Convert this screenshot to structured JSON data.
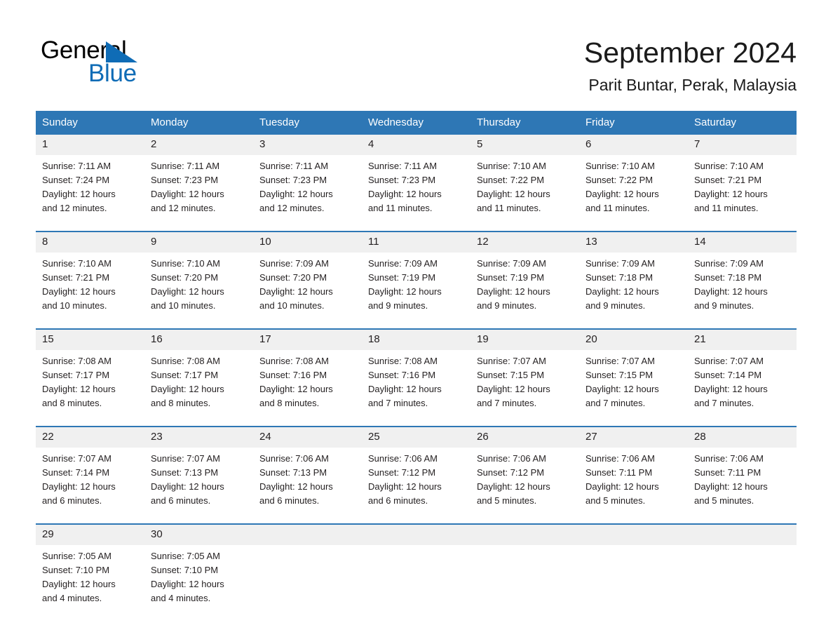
{
  "brand": {
    "name_part1": "General",
    "name_part2": "Blue",
    "triangle_color": "#0f6cb6"
  },
  "header": {
    "month_title": "September 2024",
    "location": "Parit Buntar, Perak, Malaysia"
  },
  "theme": {
    "header_blue": "#2e77b5",
    "daynum_background": "#f0f0f0",
    "text_color": "#231f20"
  },
  "calendar": {
    "weekday_headers": [
      "Sunday",
      "Monday",
      "Tuesday",
      "Wednesday",
      "Thursday",
      "Friday",
      "Saturday"
    ],
    "weeks": [
      [
        {
          "day": "1",
          "sunrise": "Sunrise: 7:11 AM",
          "sunset": "Sunset: 7:24 PM",
          "daylight_line1": "Daylight: 12 hours",
          "daylight_line2": "and 12 minutes."
        },
        {
          "day": "2",
          "sunrise": "Sunrise: 7:11 AM",
          "sunset": "Sunset: 7:23 PM",
          "daylight_line1": "Daylight: 12 hours",
          "daylight_line2": "and 12 minutes."
        },
        {
          "day": "3",
          "sunrise": "Sunrise: 7:11 AM",
          "sunset": "Sunset: 7:23 PM",
          "daylight_line1": "Daylight: 12 hours",
          "daylight_line2": "and 12 minutes."
        },
        {
          "day": "4",
          "sunrise": "Sunrise: 7:11 AM",
          "sunset": "Sunset: 7:23 PM",
          "daylight_line1": "Daylight: 12 hours",
          "daylight_line2": "and 11 minutes."
        },
        {
          "day": "5",
          "sunrise": "Sunrise: 7:10 AM",
          "sunset": "Sunset: 7:22 PM",
          "daylight_line1": "Daylight: 12 hours",
          "daylight_line2": "and 11 minutes."
        },
        {
          "day": "6",
          "sunrise": "Sunrise: 7:10 AM",
          "sunset": "Sunset: 7:22 PM",
          "daylight_line1": "Daylight: 12 hours",
          "daylight_line2": "and 11 minutes."
        },
        {
          "day": "7",
          "sunrise": "Sunrise: 7:10 AM",
          "sunset": "Sunset: 7:21 PM",
          "daylight_line1": "Daylight: 12 hours",
          "daylight_line2": "and 11 minutes."
        }
      ],
      [
        {
          "day": "8",
          "sunrise": "Sunrise: 7:10 AM",
          "sunset": "Sunset: 7:21 PM",
          "daylight_line1": "Daylight: 12 hours",
          "daylight_line2": "and 10 minutes."
        },
        {
          "day": "9",
          "sunrise": "Sunrise: 7:10 AM",
          "sunset": "Sunset: 7:20 PM",
          "daylight_line1": "Daylight: 12 hours",
          "daylight_line2": "and 10 minutes."
        },
        {
          "day": "10",
          "sunrise": "Sunrise: 7:09 AM",
          "sunset": "Sunset: 7:20 PM",
          "daylight_line1": "Daylight: 12 hours",
          "daylight_line2": "and 10 minutes."
        },
        {
          "day": "11",
          "sunrise": "Sunrise: 7:09 AM",
          "sunset": "Sunset: 7:19 PM",
          "daylight_line1": "Daylight: 12 hours",
          "daylight_line2": "and 9 minutes."
        },
        {
          "day": "12",
          "sunrise": "Sunrise: 7:09 AM",
          "sunset": "Sunset: 7:19 PM",
          "daylight_line1": "Daylight: 12 hours",
          "daylight_line2": "and 9 minutes."
        },
        {
          "day": "13",
          "sunrise": "Sunrise: 7:09 AM",
          "sunset": "Sunset: 7:18 PM",
          "daylight_line1": "Daylight: 12 hours",
          "daylight_line2": "and 9 minutes."
        },
        {
          "day": "14",
          "sunrise": "Sunrise: 7:09 AM",
          "sunset": "Sunset: 7:18 PM",
          "daylight_line1": "Daylight: 12 hours",
          "daylight_line2": "and 9 minutes."
        }
      ],
      [
        {
          "day": "15",
          "sunrise": "Sunrise: 7:08 AM",
          "sunset": "Sunset: 7:17 PM",
          "daylight_line1": "Daylight: 12 hours",
          "daylight_line2": "and 8 minutes."
        },
        {
          "day": "16",
          "sunrise": "Sunrise: 7:08 AM",
          "sunset": "Sunset: 7:17 PM",
          "daylight_line1": "Daylight: 12 hours",
          "daylight_line2": "and 8 minutes."
        },
        {
          "day": "17",
          "sunrise": "Sunrise: 7:08 AM",
          "sunset": "Sunset: 7:16 PM",
          "daylight_line1": "Daylight: 12 hours",
          "daylight_line2": "and 8 minutes."
        },
        {
          "day": "18",
          "sunrise": "Sunrise: 7:08 AM",
          "sunset": "Sunset: 7:16 PM",
          "daylight_line1": "Daylight: 12 hours",
          "daylight_line2": "and 7 minutes."
        },
        {
          "day": "19",
          "sunrise": "Sunrise: 7:07 AM",
          "sunset": "Sunset: 7:15 PM",
          "daylight_line1": "Daylight: 12 hours",
          "daylight_line2": "and 7 minutes."
        },
        {
          "day": "20",
          "sunrise": "Sunrise: 7:07 AM",
          "sunset": "Sunset: 7:15 PM",
          "daylight_line1": "Daylight: 12 hours",
          "daylight_line2": "and 7 minutes."
        },
        {
          "day": "21",
          "sunrise": "Sunrise: 7:07 AM",
          "sunset": "Sunset: 7:14 PM",
          "daylight_line1": "Daylight: 12 hours",
          "daylight_line2": "and 7 minutes."
        }
      ],
      [
        {
          "day": "22",
          "sunrise": "Sunrise: 7:07 AM",
          "sunset": "Sunset: 7:14 PM",
          "daylight_line1": "Daylight: 12 hours",
          "daylight_line2": "and 6 minutes."
        },
        {
          "day": "23",
          "sunrise": "Sunrise: 7:07 AM",
          "sunset": "Sunset: 7:13 PM",
          "daylight_line1": "Daylight: 12 hours",
          "daylight_line2": "and 6 minutes."
        },
        {
          "day": "24",
          "sunrise": "Sunrise: 7:06 AM",
          "sunset": "Sunset: 7:13 PM",
          "daylight_line1": "Daylight: 12 hours",
          "daylight_line2": "and 6 minutes."
        },
        {
          "day": "25",
          "sunrise": "Sunrise: 7:06 AM",
          "sunset": "Sunset: 7:12 PM",
          "daylight_line1": "Daylight: 12 hours",
          "daylight_line2": "and 6 minutes."
        },
        {
          "day": "26",
          "sunrise": "Sunrise: 7:06 AM",
          "sunset": "Sunset: 7:12 PM",
          "daylight_line1": "Daylight: 12 hours",
          "daylight_line2": "and 5 minutes."
        },
        {
          "day": "27",
          "sunrise": "Sunrise: 7:06 AM",
          "sunset": "Sunset: 7:11 PM",
          "daylight_line1": "Daylight: 12 hours",
          "daylight_line2": "and 5 minutes."
        },
        {
          "day": "28",
          "sunrise": "Sunrise: 7:06 AM",
          "sunset": "Sunset: 7:11 PM",
          "daylight_line1": "Daylight: 12 hours",
          "daylight_line2": "and 5 minutes."
        }
      ],
      [
        {
          "day": "29",
          "sunrise": "Sunrise: 7:05 AM",
          "sunset": "Sunset: 7:10 PM",
          "daylight_line1": "Daylight: 12 hours",
          "daylight_line2": "and 4 minutes."
        },
        {
          "day": "30",
          "sunrise": "Sunrise: 7:05 AM",
          "sunset": "Sunset: 7:10 PM",
          "daylight_line1": "Daylight: 12 hours",
          "daylight_line2": "and 4 minutes."
        },
        {
          "day": "",
          "sunrise": "",
          "sunset": "",
          "daylight_line1": "",
          "daylight_line2": ""
        },
        {
          "day": "",
          "sunrise": "",
          "sunset": "",
          "daylight_line1": "",
          "daylight_line2": ""
        },
        {
          "day": "",
          "sunrise": "",
          "sunset": "",
          "daylight_line1": "",
          "daylight_line2": ""
        },
        {
          "day": "",
          "sunrise": "",
          "sunset": "",
          "daylight_line1": "",
          "daylight_line2": ""
        },
        {
          "day": "",
          "sunrise": "",
          "sunset": "",
          "daylight_line1": "",
          "daylight_line2": ""
        }
      ]
    ]
  }
}
